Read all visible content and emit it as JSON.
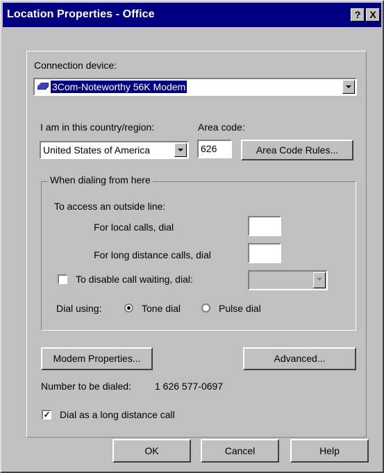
{
  "window": {
    "title": "Location Properties - Office",
    "help_button": "?",
    "close_button": "X"
  },
  "connection_device": {
    "label": "Connection device:",
    "selected": "3Com-Noteworthy 56K Modem",
    "icon": "modem-icon"
  },
  "location": {
    "country_label": "I am in this country/region:",
    "country_value": "United States of America",
    "area_code_label": "Area code:",
    "area_code_value": "626",
    "area_code_rules_button": "Area Code Rules..."
  },
  "dialing": {
    "group_title": "When dialing from here",
    "outside_line_label": "To access an outside line:",
    "local_calls_label": "For local calls, dial",
    "local_calls_value": "",
    "long_distance_label": "For long distance calls, dial",
    "long_distance_value": "",
    "disable_call_waiting_label": "To disable call waiting, dial:",
    "disable_call_waiting_checked": false,
    "call_waiting_value": "",
    "dial_using_label": "Dial using:",
    "tone_label": "Tone dial",
    "pulse_label": "Pulse dial",
    "selected_mode": "tone"
  },
  "buttons": {
    "modem_properties": "Modem Properties...",
    "advanced": "Advanced...",
    "ok": "OK",
    "cancel": "Cancel",
    "help": "Help"
  },
  "number": {
    "label": "Number to be dialed:",
    "value": "1 626 577-0697"
  },
  "long_distance_call": {
    "label": "Dial as a long distance call",
    "checked": true
  },
  "colors": {
    "titlebar": "#000080",
    "face": "#c0c0c0",
    "highlight": "#000080"
  }
}
